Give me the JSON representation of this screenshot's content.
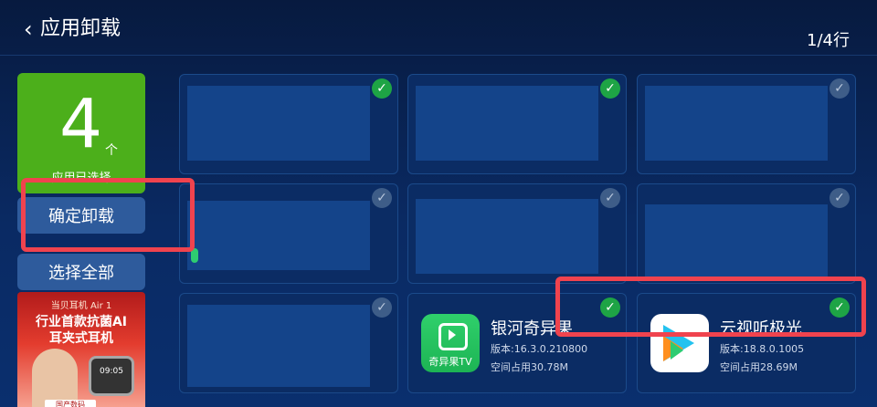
{
  "header": {
    "back_icon": "‹",
    "title": "应用卸载",
    "page_indicator": "1/4行"
  },
  "selection": {
    "count": "4",
    "unit": "个",
    "label": "应用已选择"
  },
  "buttons": {
    "confirm": "确定卸载",
    "select_all": "选择全部"
  },
  "ad": {
    "line1": "当贝耳机 Air 1",
    "line2": "行业首款抗菌AI",
    "line3": "耳夹式耳机",
    "device_time": "09:05",
    "badge": "国产数码"
  },
  "check_glyph": "✓",
  "tiles": [
    {
      "checked": true
    },
    {
      "checked": true
    },
    {
      "checked": false
    },
    {
      "checked": false
    },
    {
      "checked": false
    },
    {
      "checked": false
    },
    {
      "checked": false
    },
    {
      "checked": true,
      "app": {
        "name": "银河奇异果",
        "icon_label": "奇异果TV",
        "version": "版本:16.3.0.210800",
        "size": "空间占用30.78M",
        "icon": "qiyiguo-tv-icon"
      }
    },
    {
      "checked": true,
      "app": {
        "name": "云视听极光",
        "version": "版本:18.8.0.1005",
        "size": "空间占用28.69M",
        "icon": "yunshiting-jiguang-icon"
      }
    }
  ],
  "colors": {
    "accent_green": "#4caf1b",
    "check_green": "#1ea445",
    "highlight_red": "#f0434e"
  }
}
